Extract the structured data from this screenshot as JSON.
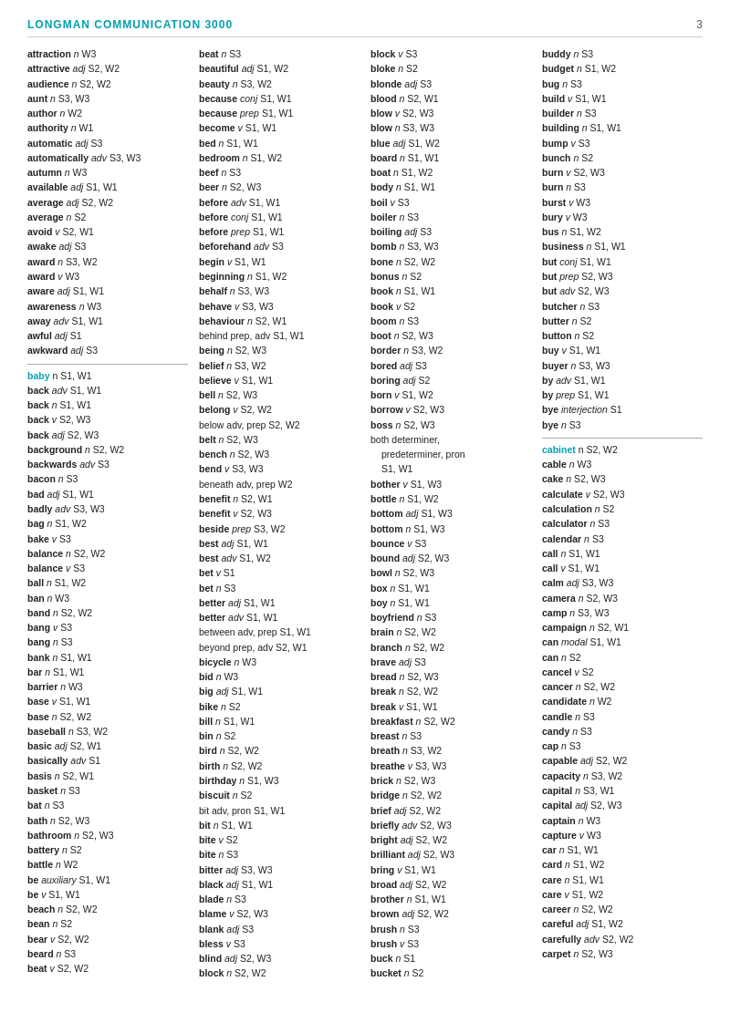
{
  "header": {
    "title": "LONGMAN COMMUNICATION 3000",
    "page": "3"
  },
  "columns": [
    {
      "id": "col1",
      "entries": [
        "attraction n W3",
        "attractive adj S2, W2",
        "audience n S2, W2",
        "aunt n S3, W3",
        "author n W2",
        "authority n W1",
        "automatic adj S3",
        "automatically adv S3, W3",
        "autumn n W3",
        "available adj S1, W1",
        "average adj S2, W2",
        "average n S2",
        "avoid v S2, W1",
        "awake adj S3",
        "award n S3, W2",
        "award v W3",
        "aware adj S1, W1",
        "awareness n W3",
        "away adv S1, W1",
        "awful adj S1",
        "awkward adj S3",
        "DIVIDER",
        "KEYWORD:baby n S1, W1",
        "back adv S1, W1",
        "back n S1, W1",
        "back v S2, W3",
        "back adj S2, W3",
        "background n S2, W2",
        "backwards adv S3",
        "bacon n S3",
        "bad adj S1, W1",
        "badly adv S3, W3",
        "bag n S1, W2",
        "bake v S3",
        "balance n S2, W2",
        "balance v S3",
        "ball n S1, W2",
        "ban n W3",
        "band n S2, W2",
        "bang v S3",
        "bang n S3",
        "bank n S1, W1",
        "bar n S1, W1",
        "barrier n W3",
        "base v S1, W1",
        "base n S2, W2",
        "baseball n S3, W2",
        "basic adj S2, W1",
        "basically adv S1",
        "basis n S2, W1",
        "basket n S3",
        "bat n S3",
        "bath n S2, W3",
        "bathroom n S2, W3",
        "battery n S2",
        "battle n W2",
        "be auxiliary S1, W1",
        "be v S1, W1",
        "beach n S2, W2",
        "bean n S2",
        "bear v S2, W2",
        "beard n S3",
        "beat v S2, W2"
      ]
    },
    {
      "id": "col2",
      "entries": [
        "beat n S3",
        "beautiful adj S1, W2",
        "beauty n S3, W2",
        "because conj S1, W1",
        "because prep S1, W1",
        "become v S1, W1",
        "bed n S1, W1",
        "bedroom n S1, W2",
        "beef n S3",
        "beer n S2, W3",
        "before adv S1, W1",
        "before conj S1, W1",
        "before prep S1, W1",
        "beforehand adv S3",
        "begin v S1, W1",
        "beginning n S1, W2",
        "behalf n S3, W3",
        "behave v S3, W3",
        "behaviour n S2, W1",
        "behind prep, adv S1, W1",
        "being n S2, W3",
        "belief n S3, W2",
        "believe v S1, W1",
        "bell n S2, W3",
        "belong v S2, W2",
        "below adv, prep S2, W2",
        "belt n S2, W3",
        "bench n S2, W3",
        "bend v S3, W3",
        "beneath adv, prep W2",
        "benefit n S2, W1",
        "benefit v S2, W3",
        "beside prep S3, W2",
        "best adj S1, W1",
        "best adv S1, W2",
        "bet v S1",
        "bet n S3",
        "better adj S1, W1",
        "better adv S1, W1",
        "between adv, prep S1, W1",
        "beyond prep, adv S2, W1",
        "bicycle n W3",
        "bid n W3",
        "big adj S1, W1",
        "bike n S2",
        "bill n S1, W1",
        "bin n S2",
        "bird n S2, W2",
        "birth n S2, W2",
        "birthday n S1, W3",
        "biscuit n S2",
        "bit adv, pron S1, W1",
        "bit n S1, W1",
        "bite v S2",
        "bite n S3",
        "bitter adj S3, W3",
        "black adj S1, W1",
        "blade n S3",
        "blame v S2, W3",
        "blank adj S3",
        "bless v S3",
        "blind adj S2, W3",
        "block n S2, W2"
      ]
    },
    {
      "id": "col3",
      "entries": [
        "block v S3",
        "bloke n S2",
        "blonde adj S3",
        "blood n S2, W1",
        "blow v S2, W3",
        "blow n S3, W3",
        "blue adj S1, W2",
        "board n S1, W1",
        "boat n S1, W2",
        "body n S1, W1",
        "boil v S3",
        "boiler n S3",
        "boiling adj S3",
        "bomb n S3, W3",
        "bone n S2, W2",
        "bonus n S2",
        "book n S1, W1",
        "book v S2",
        "boom n S3",
        "boot n S2, W3",
        "border n S3, W2",
        "bored adj S3",
        "boring adj S2",
        "born v S1, W2",
        "borrow v S2, W3",
        "boss n S2, W3",
        "both determiner,",
        "  predeterminer, pron",
        "  S1, W1",
        "bother v S1, W3",
        "bottle n S1, W2",
        "bottom adj S1, W3",
        "bottom n S1, W3",
        "bounce v S3",
        "bound adj S2, W3",
        "bowl n S2, W3",
        "box n S1, W1",
        "boy n S1, W1",
        "boyfriend n S3",
        "brain n S2, W2",
        "branch n S2, W2",
        "brave adj S3",
        "bread n S2, W3",
        "break n S2, W2",
        "break v S1, W1",
        "breakfast n S2, W2",
        "breast n S3",
        "breath n S3, W2",
        "breathe v S3, W3",
        "brick n S2, W3",
        "bridge n S2, W2",
        "brief adj S2, W2",
        "briefly adv S2, W3",
        "bright adj S2, W2",
        "brilliant adj S2, W3",
        "bring v S1, W1",
        "broad adj S2, W2",
        "brother n S1, W1",
        "brown adj S2, W2",
        "brush n S3",
        "brush v S3",
        "buck n S1",
        "bucket n S2"
      ]
    },
    {
      "id": "col4",
      "entries": [
        "buddy n S3",
        "budget n S1, W2",
        "bug n S3",
        "build v S1, W1",
        "builder n S3",
        "building n S1, W1",
        "bump v S3",
        "bunch n S2",
        "burn v S2, W3",
        "burn n S3",
        "burst v W3",
        "bury v W3",
        "bus n S1, W2",
        "business n S1, W1",
        "but conj S1, W1",
        "but prep S2, W3",
        "but adv S2, W3",
        "butcher n S3",
        "butter n S2",
        "button n S2",
        "buy v S1, W1",
        "buyer n S3, W3",
        "by adv S1, W1",
        "by prep S1, W1",
        "bye interjection S1",
        "bye n S3",
        "DIVIDER",
        "KEYWORD:cabinet n S2, W2",
        "cable n W3",
        "cake n S2, W3",
        "calculate v S2, W3",
        "calculation n S2",
        "calculator n S3",
        "calendar n S3",
        "call n S1, W1",
        "call v S1, W1",
        "calm adj S3, W3",
        "camera n S2, W3",
        "camp n S3, W3",
        "campaign n S2, W1",
        "can modal S1, W1",
        "can n S2",
        "cancel v S2",
        "cancer n S2, W2",
        "candidate n W2",
        "candle n S3",
        "candy n S3",
        "cap n S3",
        "capable adj S2, W2",
        "capacity n S3, W2",
        "capital n S3, W1",
        "capital adj S2, W3",
        "captain n W3",
        "capture v W3",
        "car n S1, W1",
        "card n S1, W2",
        "care n S1, W1",
        "care v S1, W2",
        "career n S2, W2",
        "careful adj S1, W2",
        "carefully adv S2, W2",
        "carpet n S2, W3"
      ]
    }
  ]
}
